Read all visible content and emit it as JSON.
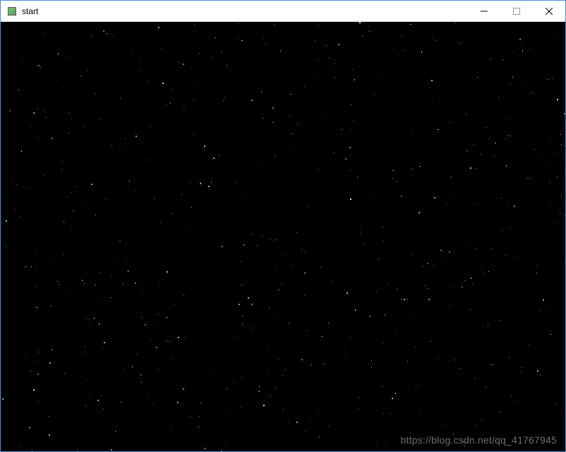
{
  "window": {
    "title": "start",
    "controls": {
      "minimize": "minimize",
      "maximize": "maximize",
      "close": "close"
    }
  },
  "content": {
    "background": "#000000",
    "star_color": "#ffffff",
    "star_count": 500
  },
  "watermark": {
    "text": "https://blog.csdn.net/qq_41767945"
  }
}
